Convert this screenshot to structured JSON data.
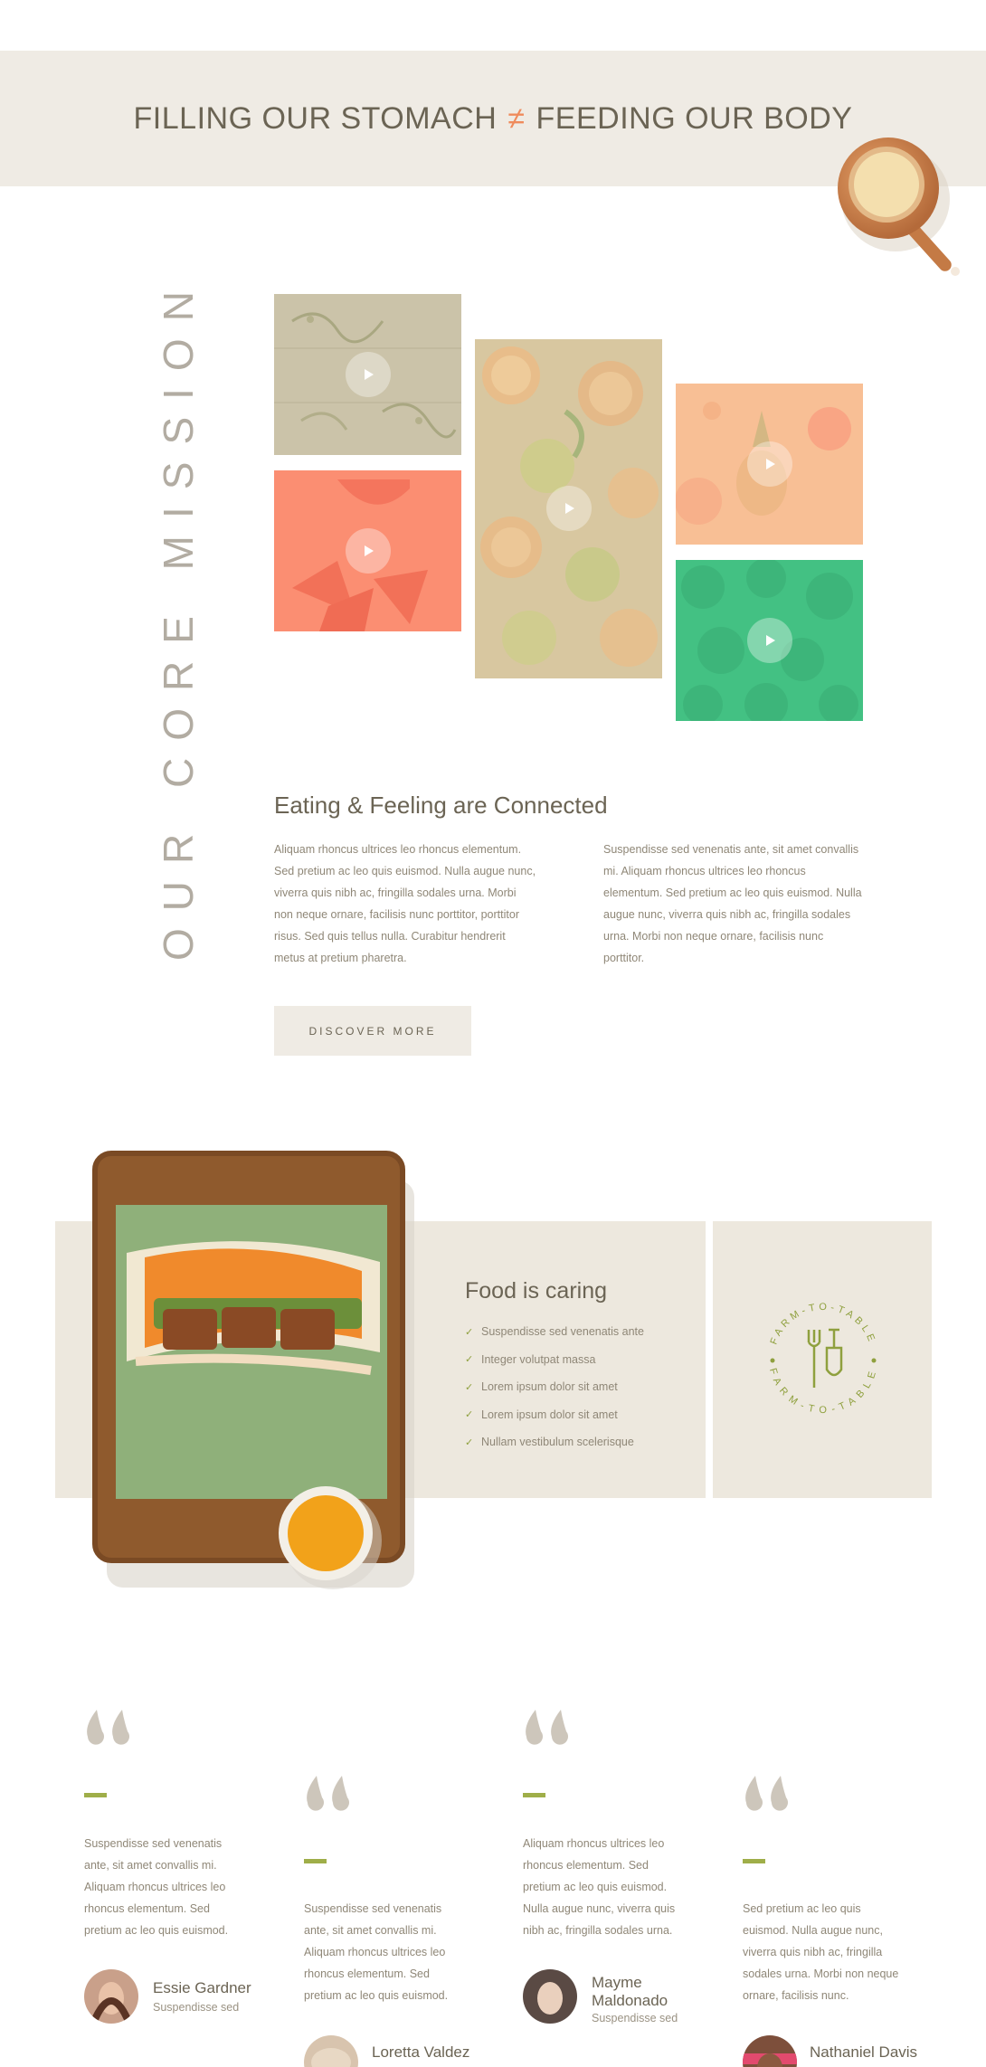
{
  "banner": {
    "title_left": "FILLING OUR STOMACH",
    "symbol": "≠",
    "title_right": "FEEDING OUR BODY"
  },
  "mission": {
    "vertical_heading": "OUR CORE MISSION",
    "title": "Eating & Feeling are Connected",
    "para_left": "Aliquam rhoncus ultrices leo rhoncus elementum. Sed pretium ac leo quis euismod. Nulla augue nunc, viverra quis nibh ac, fringilla sodales urna. Morbi non neque ornare, facilisis nunc porttitor, porttitor risus. Sed quis tellus nulla. Curabitur hendrerit metus at pretium pharetra.",
    "para_right": "Suspendisse sed venenatis ante, sit amet convallis mi. Aliquam rhoncus ultrices leo rhoncus elementum. Sed pretium ac leo quis euismod. Nulla augue nunc, viverra quis nibh ac, fringilla sodales urna. Morbi non neque ornare, facilisis nunc porttitor.",
    "button": "DISCOVER MORE",
    "videos": [
      {
        "icon": "play-icon",
        "color": "#cfc7ae"
      },
      {
        "icon": "play-icon",
        "color": "#fc8e71"
      },
      {
        "icon": "play-icon",
        "color": "#dcc9a2"
      },
      {
        "icon": "play-icon",
        "color": "#f8bf95"
      },
      {
        "icon": "play-icon",
        "color": "#43c183"
      }
    ]
  },
  "caring": {
    "title": "Food is caring",
    "items": [
      "Suspendisse sed venenatis ante",
      "Integer volutpat massa",
      "Lorem ipsum dolor sit amet",
      "Lorem ipsum dolor sit amet",
      "Nullam vestibulum scelerisque"
    ],
    "badge_top": "FARM-TO-TABLE",
    "badge_bottom": "FARM-TO-TABLE"
  },
  "testimonials": [
    {
      "quote": "Suspendisse sed venenatis ante, sit amet convallis mi. Aliquam rhoncus ultrices leo rhoncus elementum. Sed pretium ac leo quis euismod.",
      "name": "Essie Gardner",
      "role": "Suspendisse sed"
    },
    {
      "quote": "Suspendisse sed venenatis ante, sit amet convallis mi. Aliquam rhoncus ultrices leo rhoncus elementum. Sed pretium ac leo quis euismod.",
      "name": "Loretta Valdez",
      "role": ""
    },
    {
      "quote": "Aliquam rhoncus ultrices leo rhoncus elementum. Sed pretium ac leo quis euismod. Nulla augue nunc, viverra quis nibh ac, fringilla sodales urna.",
      "name": "Mayme Maldonado",
      "role": "Suspendisse sed"
    },
    {
      "quote": "Sed pretium ac leo quis euismod. Nulla augue nunc, viverra quis nibh ac, fringilla sodales urna. Morbi non neque ornare, facilisis nunc.",
      "name": "Nathaniel Davis",
      "role": ""
    }
  ],
  "colors": {
    "accent": "#ef8b5c",
    "green": "#9fae49",
    "beige": "#efebe4",
    "text": "#6b6454"
  }
}
